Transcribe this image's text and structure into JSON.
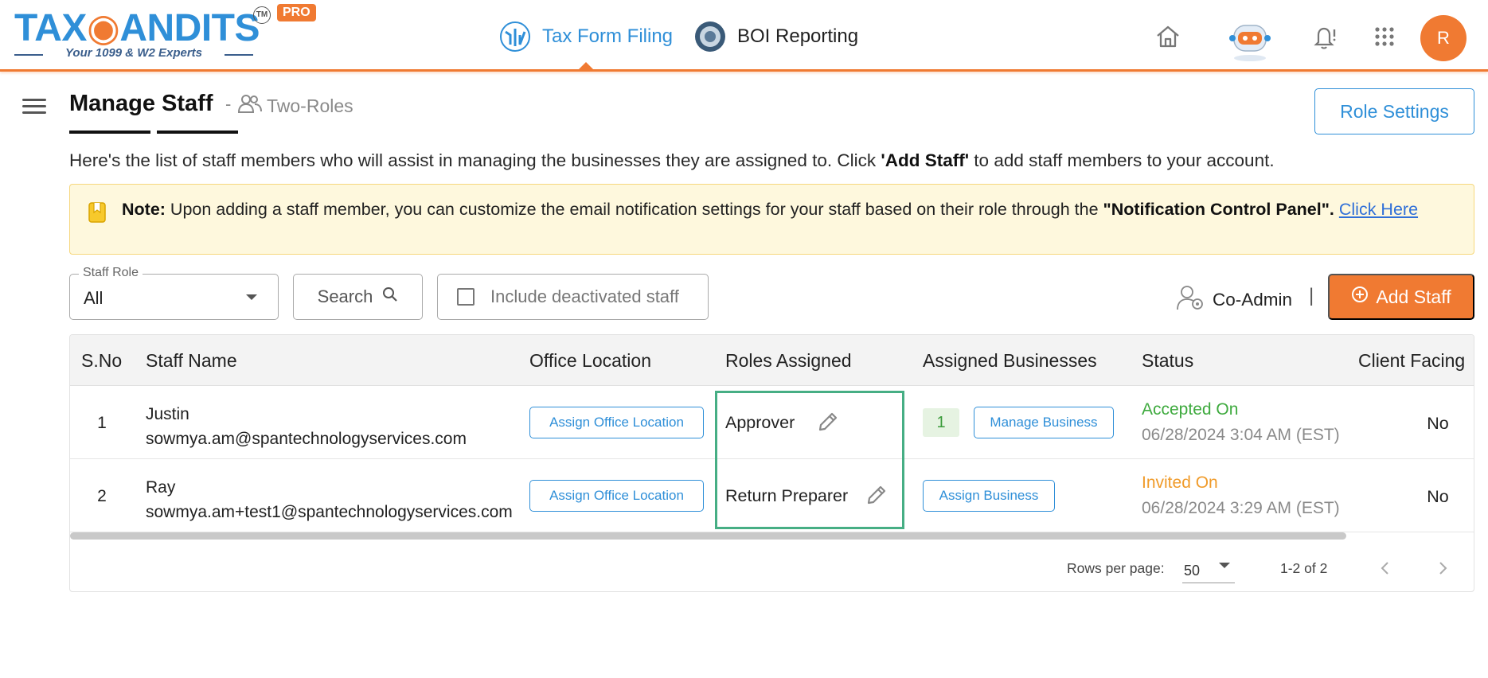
{
  "brand": {
    "logo_text_a": "TAX",
    "logo_text_b": "ANDITS",
    "tm": "TM",
    "pro_badge": "PRO",
    "tagline": "Your 1099 & W2 Experts"
  },
  "nav": {
    "tax_form_filing": "Tax Form Filing",
    "boi_reporting": "BOI Reporting"
  },
  "header_icons": [
    "home-icon",
    "robot-assistant-icon",
    "bell-icon",
    "apps-grid-icon"
  ],
  "user": {
    "avatar_initial": "R"
  },
  "page": {
    "title": "Manage Staff",
    "separator": "-",
    "role_mode": "Two-Roles",
    "role_settings_label": "Role Settings",
    "intro_pre": "Here's the list of staff members who will assist in managing the businesses they are assigned to. Click ",
    "intro_bold": "'Add Staff'",
    "intro_post": " to add staff members to your account."
  },
  "note": {
    "label": "Note:",
    "text_pre": " Upon adding a staff member, you can customize the email notification settings for your staff based on their role through the ",
    "text_bold": "\"Notification Control Panel\".",
    "link": "Click Here"
  },
  "filters": {
    "staff_role_label": "Staff Role",
    "staff_role_value": "All",
    "search_label": "Search",
    "include_deactivated_label": "Include deactivated staff",
    "include_deactivated_checked": false,
    "coadmin_label": "Co-Admin",
    "coadmin_separator": "|",
    "add_staff_label": "Add Staff"
  },
  "table": {
    "columns": [
      "S.No",
      "Staff Name",
      "Office Location",
      "Roles Assigned",
      "Assigned Businesses",
      "Status",
      "Client Facing"
    ],
    "rows": [
      {
        "sno": "1",
        "name": "Justin",
        "email": "sowmya.am@spantechnologyservices.com",
        "office_btn": "Assign Office Location",
        "role": "Approver",
        "biz_count": "1",
        "biz_btn": "Manage Business",
        "status": "Accepted On",
        "status_date": "06/28/2024 3:04 AM (EST)",
        "client_facing": "No"
      },
      {
        "sno": "2",
        "name": "Ray",
        "email": "sowmya.am+test1@spantechnologyservices.com",
        "office_btn": "Assign Office Location",
        "role": "Return Preparer",
        "biz_count": "",
        "biz_btn": "Assign Business",
        "status": "Invited On",
        "status_date": "06/28/2024 3:29 AM (EST)",
        "client_facing": "No"
      }
    ],
    "pagination": {
      "rows_per_page_label": "Rows per page:",
      "rows_per_page": "50",
      "range": "1-2 of 2"
    }
  },
  "colors": {
    "brand_blue": "#2f8fd8",
    "brand_orange": "#f07a32",
    "accepted_green": "#3eaa3e",
    "invited_orange": "#f09b2a",
    "highlight_green": "#46ae84"
  }
}
